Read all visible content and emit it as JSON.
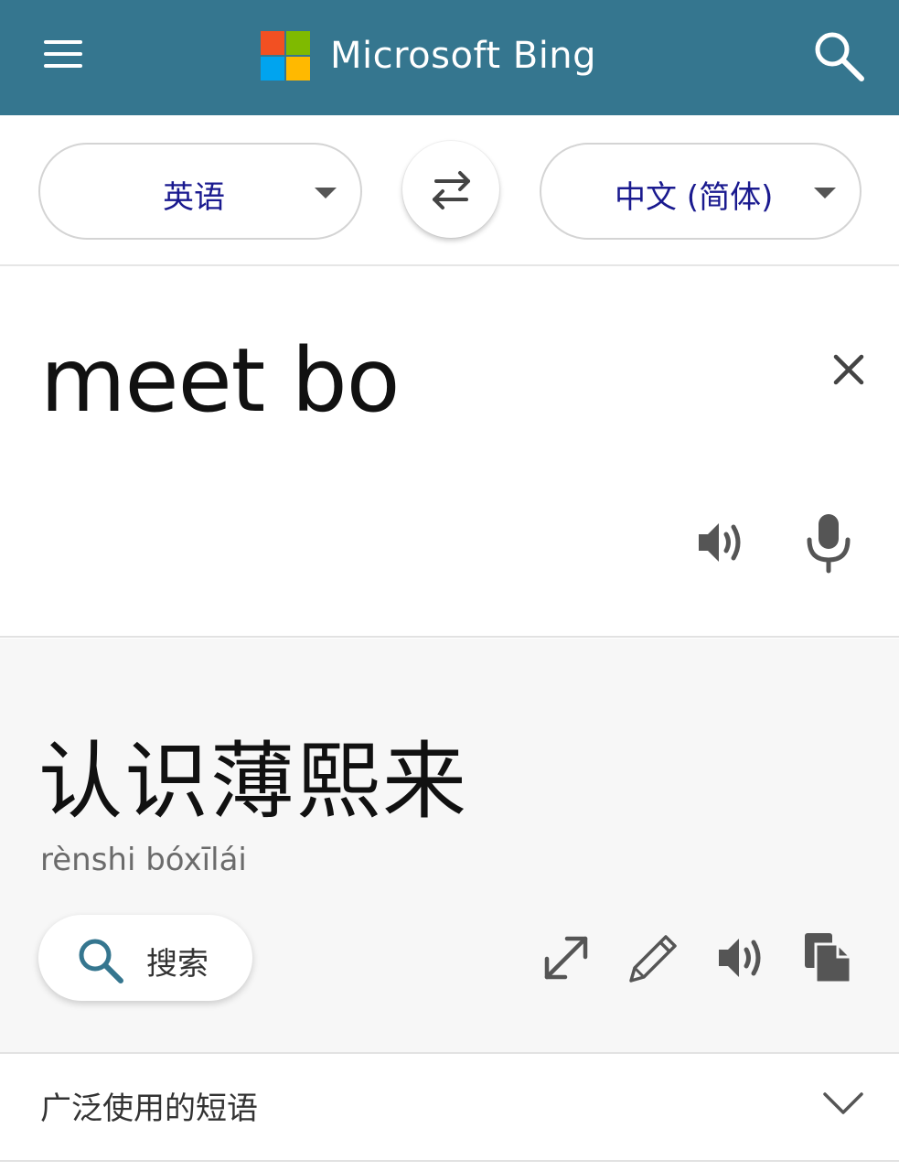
{
  "header": {
    "brand": "Microsoft Bing",
    "background_color": "#35768f",
    "menu_icon": "hamburger-menu-icon",
    "search_icon": "search-icon",
    "logo_colors": [
      "#f25022",
      "#7fba00",
      "#00a4ef",
      "#ffb900"
    ]
  },
  "languages": {
    "source": "英语",
    "target": "中文 (简体)",
    "swap_icon": "swap-arrows-icon",
    "accent_color": "#1a1a8f"
  },
  "source": {
    "text": "meet bo",
    "clear_icon": "close-icon",
    "speaker_icon": "speaker-icon",
    "mic_icon": "microphone-icon"
  },
  "result": {
    "text": "认识薄熙来",
    "pinyin": "rènshi bóxīlái",
    "search_label": "搜索",
    "search_icon": "search-icon",
    "search_icon_color": "#35768f",
    "actions": [
      "expand-icon",
      "pencil-edit-icon",
      "speaker-icon",
      "copy-icon"
    ]
  },
  "phrases": {
    "label": "广泛使用的短语",
    "chevron_icon": "chevron-down-icon"
  }
}
